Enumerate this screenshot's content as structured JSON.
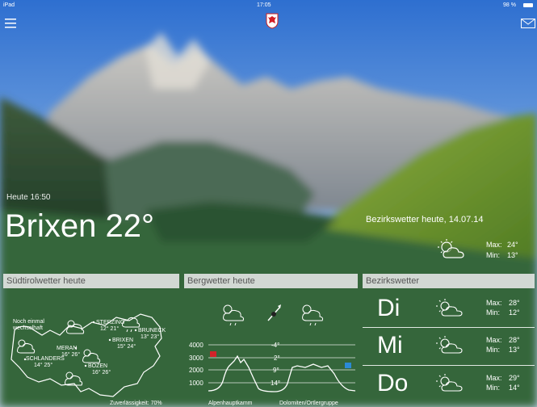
{
  "status_bar": {
    "device": "iPad",
    "time": "17:05",
    "battery": "98 %"
  },
  "menu_icon": "hamburger-menu-icon",
  "logo_icon": "south-tyrol-eagle-shield-icon",
  "mail_icon": "envelope-icon",
  "current": {
    "updated": "Heute 16:50",
    "city_temp": "Brixen 22°"
  },
  "district_today": {
    "title": "Bezirkswetter heute, 14.07.14",
    "icon": "sun-behind-cloud-icon",
    "max_label": "Max:",
    "max": "24°",
    "min_label": "Min:",
    "min": "13°"
  },
  "panels": {
    "suedtirol": {
      "title": "Südtirolwetter heute",
      "note_line1": "Noch einmal",
      "note_line2": "wechselhaft",
      "reliability": "Zuverlässigkeit: 70%",
      "cities": [
        {
          "name": "STERZING",
          "temps": "12° 21°"
        },
        {
          "name": "BRUNECK",
          "temps": "13° 23°"
        },
        {
          "name": "BRIXEN",
          "temps": "15° 24°"
        },
        {
          "name": "MERAN",
          "temps": "16° 26°"
        },
        {
          "name": "SCHLANDERS",
          "temps": "14° 25°"
        },
        {
          "name": "BOZEN",
          "temps": "16° 26°"
        }
      ]
    },
    "berg": {
      "title": "Bergwetter heute",
      "altitudes": [
        "4000",
        "3000",
        "2000",
        "1000"
      ],
      "temps": [
        "-4°",
        "2°",
        "9°",
        "14°"
      ],
      "label_left": "Alpenhauptkamm",
      "label_right": "Dolomiten/Ortlergruppe",
      "icons": [
        "sun-cloud-shower-icon",
        "wind-vane-icon",
        "cloud-shower-icon"
      ]
    },
    "bezirk": {
      "title": "Bezirkswetter",
      "max_label": "Max:",
      "min_label": "Min:",
      "days": [
        {
          "day": "Di",
          "icon": "sun-behind-cloud-icon",
          "max": "28°",
          "min": "12°"
        },
        {
          "day": "Mi",
          "icon": "sun-behind-cloud-icon",
          "max": "28°",
          "min": "13°"
        },
        {
          "day": "Do",
          "icon": "sun-behind-cloud-icon",
          "max": "29°",
          "min": "14°"
        }
      ]
    }
  }
}
